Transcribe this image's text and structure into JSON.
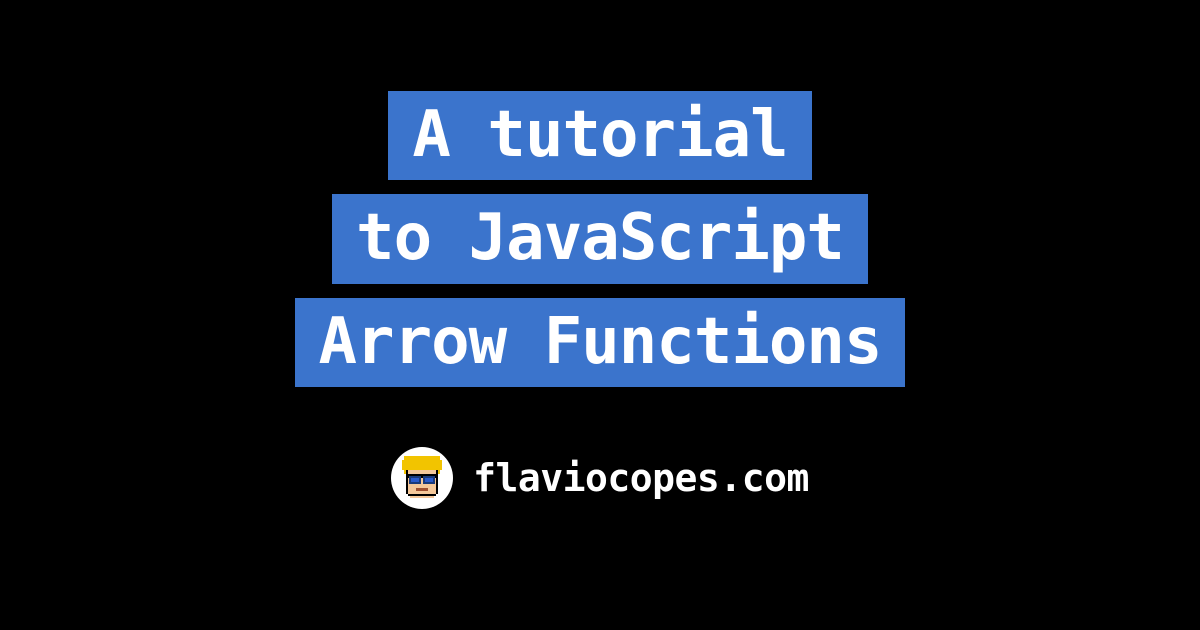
{
  "title": {
    "lines": [
      "A tutorial",
      "to JavaScript",
      "Arrow Functions"
    ]
  },
  "footer": {
    "site": "flaviocopes.com"
  },
  "colors": {
    "background": "#000000",
    "highlight": "#3b74cc",
    "text": "#ffffff"
  }
}
